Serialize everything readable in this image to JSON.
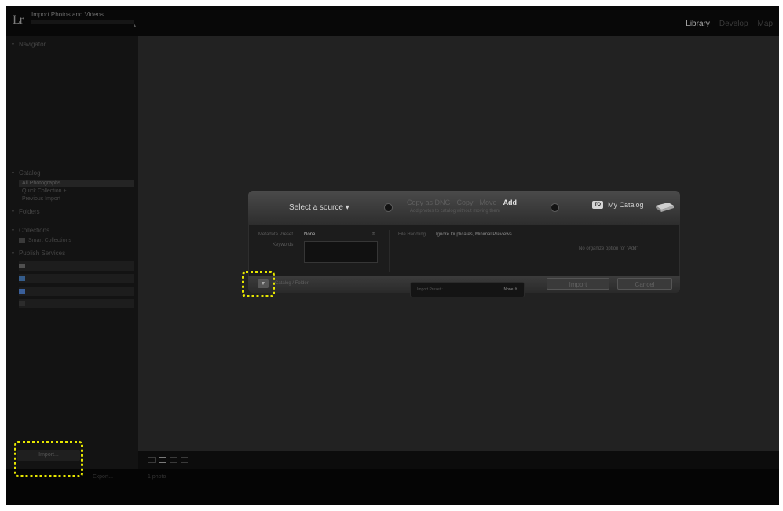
{
  "window": {
    "logo": "Lr",
    "title": "Import Photos and Videos",
    "modules": [
      {
        "label": "Library",
        "active": true
      },
      {
        "label": "Develop",
        "active": false
      },
      {
        "label": "Map",
        "active": false
      }
    ]
  },
  "left_panel": {
    "navigator_header": "Navigator",
    "catalog_header": "Catalog",
    "catalog_items": [
      "All Photographs",
      "Quick Collection +",
      "Previous Import"
    ],
    "folders_header": "Folders",
    "collections_header": "Collections",
    "smart_collections": "Smart Collections",
    "publish_header": "Publish Services"
  },
  "dialog": {
    "source_label": "Select a source",
    "modes": [
      "Copy as DNG",
      "Copy",
      "Move",
      "Add"
    ],
    "selected_mode": "Add",
    "mode_hint": "Add photos to catalog without moving them",
    "destination_badge": "TO",
    "destination_label": "My Catalog",
    "metadata_label": "Metadata Preset",
    "metadata_value": "None",
    "keywords_label": "Keywords",
    "file_handling_label": "File Handling",
    "file_handling_value": "Ignore Duplicates, Minimal Previews",
    "right_hint": "No organize option for \"Add\"",
    "path_text": "Catalog / Folder",
    "import_preset_label": "Import Preset :",
    "import_preset_value": "None",
    "import_button": "Import",
    "cancel_button": "Cancel"
  },
  "bottom": {
    "import_button": "Import...",
    "export_text": "Export...",
    "page_text": "1 photo"
  },
  "colors": {
    "highlight": "#e6e600",
    "background": "#222222",
    "panel": "#131313"
  }
}
